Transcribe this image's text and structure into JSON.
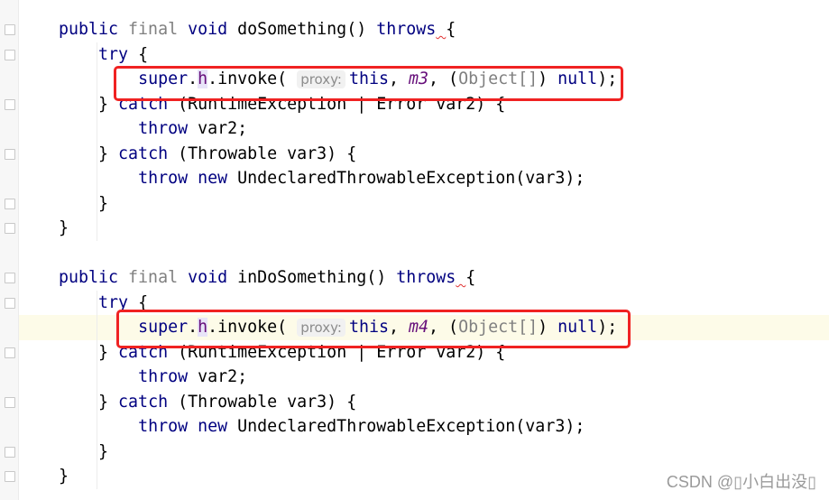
{
  "editor": {
    "highlighted_line": 12,
    "lines": [
      [
        {
          "t": "public ",
          "k": "kw"
        },
        {
          "t": "final ",
          "k": "mod"
        },
        {
          "t": "void ",
          "k": "kw"
        },
        {
          "t": "doSomething() "
        },
        {
          "t": "throws",
          "k": "kw"
        },
        {
          "t": " ",
          "k": "warn"
        },
        {
          "t": "{"
        }
      ],
      [
        {
          "t": "    "
        },
        {
          "t": "try ",
          "k": "kw"
        },
        {
          "t": "{"
        }
      ],
      [
        {
          "t": "        "
        },
        {
          "t": "super",
          "k": "kw"
        },
        {
          "t": "."
        },
        {
          "t": "h",
          "k": "field"
        },
        {
          "t": ".invoke( "
        },
        {
          "t": "proxy:",
          "k": "hint"
        },
        {
          "t": "this",
          "k": "kw"
        },
        {
          "t": ", "
        },
        {
          "t": "m3",
          "k": "fieldi"
        },
        {
          "t": ", ("
        },
        {
          "t": "Object[]",
          "k": "gray"
        },
        {
          "t": ") "
        },
        {
          "t": "null",
          "k": "kw"
        },
        {
          "t": ");"
        }
      ],
      [
        {
          "t": "    } "
        },
        {
          "t": "catch ",
          "k": "kw"
        },
        {
          "t": "(RuntimeException | Error var2) {"
        }
      ],
      [
        {
          "t": "        "
        },
        {
          "t": "throw ",
          "k": "kw"
        },
        {
          "t": "var2;"
        }
      ],
      [
        {
          "t": "    } "
        },
        {
          "t": "catch ",
          "k": "kw"
        },
        {
          "t": "(Throwable var3) {"
        }
      ],
      [
        {
          "t": "        "
        },
        {
          "t": "throw new ",
          "k": "kw"
        },
        {
          "t": "UndeclaredThrowableException(var3);"
        }
      ],
      [
        {
          "t": "    }"
        }
      ],
      [
        {
          "t": "}"
        }
      ],
      [],
      [
        {
          "t": "public ",
          "k": "kw"
        },
        {
          "t": "final ",
          "k": "mod"
        },
        {
          "t": "void ",
          "k": "kw"
        },
        {
          "t": "inDoSomething() "
        },
        {
          "t": "throws",
          "k": "kw"
        },
        {
          "t": " ",
          "k": "warn"
        },
        {
          "t": "{"
        }
      ],
      [
        {
          "t": "    "
        },
        {
          "t": "try ",
          "k": "kw"
        },
        {
          "t": "{"
        }
      ],
      [
        {
          "t": "        "
        },
        {
          "t": "super",
          "k": "kw"
        },
        {
          "t": "."
        },
        {
          "t": "h",
          "k": "field"
        },
        {
          "t": ".invoke( "
        },
        {
          "t": "proxy:",
          "k": "hint"
        },
        {
          "t": "this",
          "k": "kw"
        },
        {
          "t": ", "
        },
        {
          "t": "m4",
          "k": "fieldi"
        },
        {
          "t": ", ("
        },
        {
          "t": "Object[]",
          "k": "gray"
        },
        {
          "t": ") "
        },
        {
          "t": "null",
          "k": "kw"
        },
        {
          "t": ");"
        }
      ],
      [
        {
          "t": "    } "
        },
        {
          "t": "catch ",
          "k": "kw"
        },
        {
          "t": "(RuntimeException | Error var2) {"
        }
      ],
      [
        {
          "t": "        "
        },
        {
          "t": "throw ",
          "k": "kw"
        },
        {
          "t": "var2;"
        }
      ],
      [
        {
          "t": "    } "
        },
        {
          "t": "catch ",
          "k": "kw"
        },
        {
          "t": "(Throwable var3) {"
        }
      ],
      [
        {
          "t": "        "
        },
        {
          "t": "throw new ",
          "k": "kw"
        },
        {
          "t": "UndeclaredThrowableException(var3);"
        }
      ],
      [
        {
          "t": "    }"
        }
      ],
      [
        {
          "t": "}"
        }
      ]
    ]
  },
  "annotation_color": "#f02222",
  "watermark": "CSDN @▯小白出没▯"
}
